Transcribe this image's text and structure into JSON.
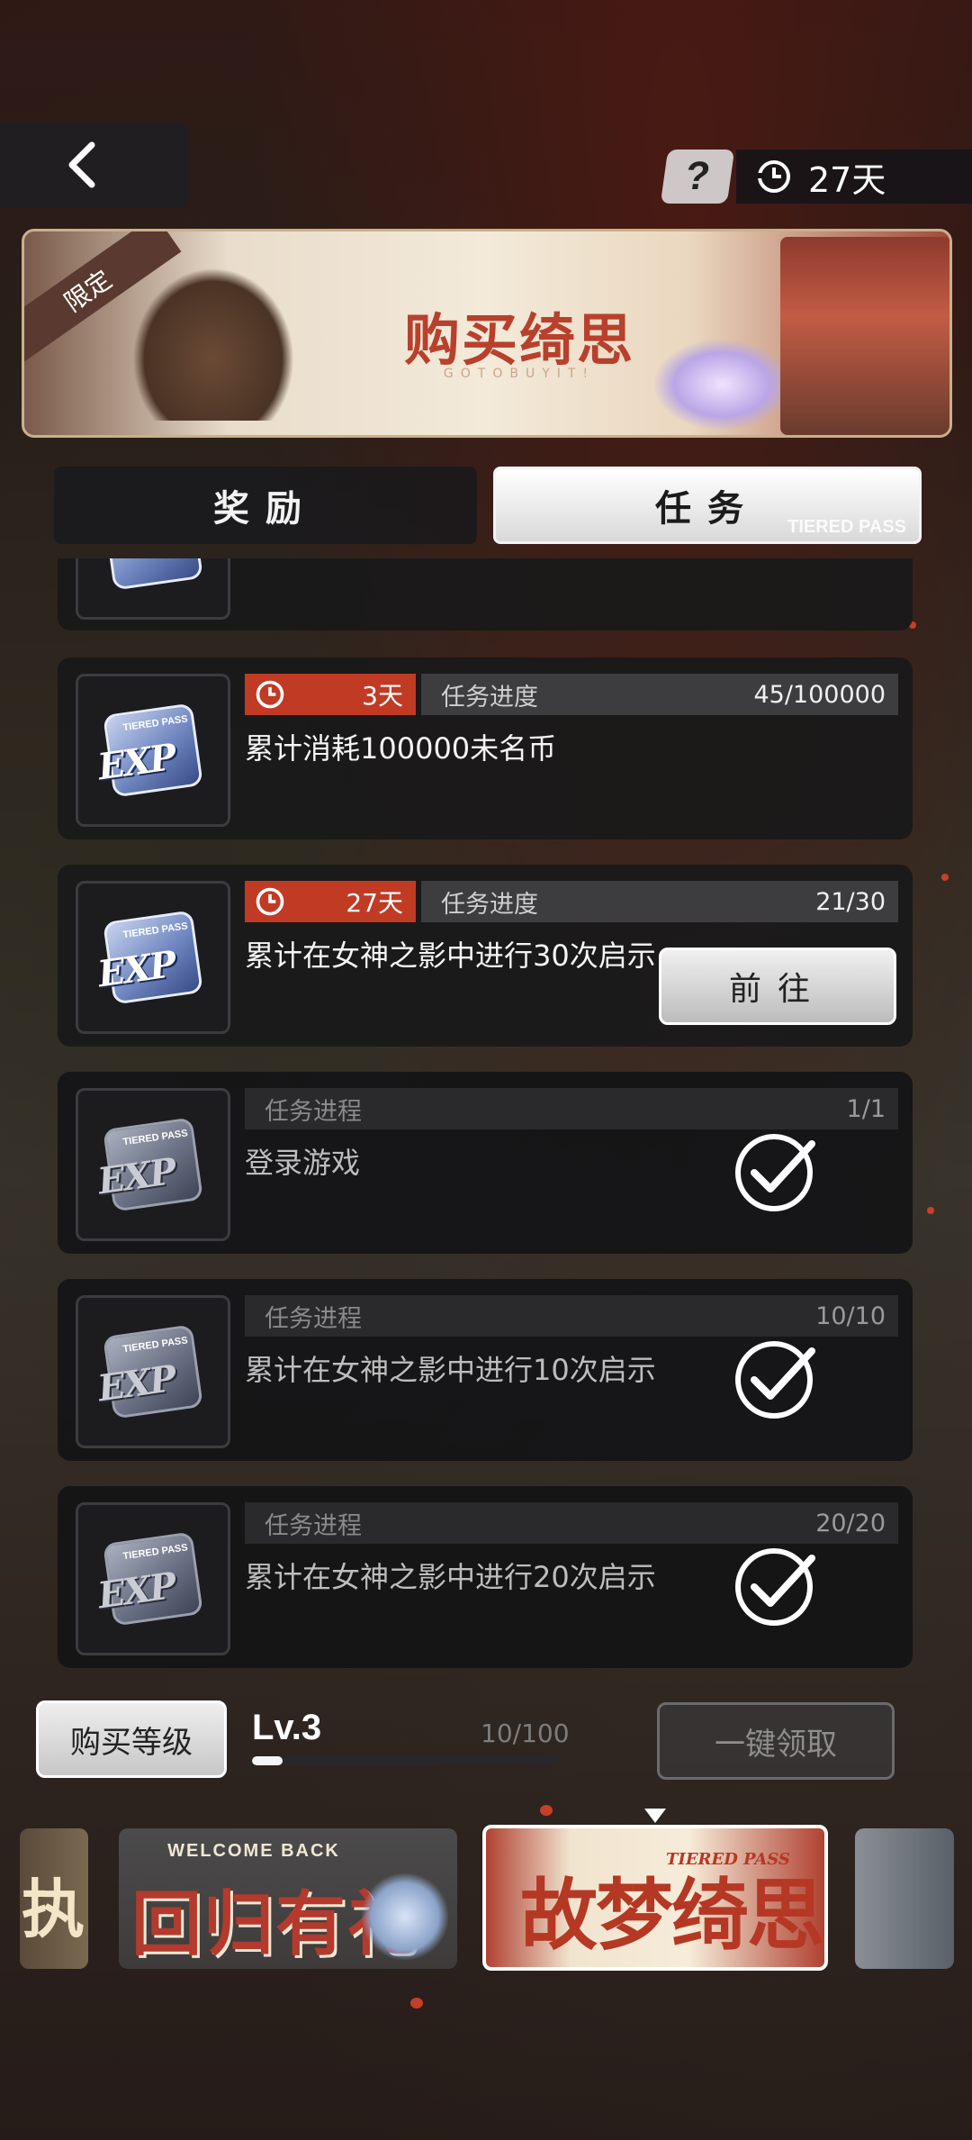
{
  "header": {
    "help_label": "?",
    "days_left": "27天"
  },
  "banner": {
    "ribbon": "限定",
    "title": "购买绮思",
    "subtitle": "GOTOBUYIT!"
  },
  "tabs": [
    {
      "label": "奖励",
      "active": false
    },
    {
      "label": "任务",
      "active": true,
      "sub": "TIERED PASS"
    }
  ],
  "tasks": [
    {
      "time": "3天",
      "progress_label": "任务进度",
      "progress": "45/100000",
      "title": "累计消耗100000未名币",
      "state": "in_progress"
    },
    {
      "time": "27天",
      "progress_label": "任务进度",
      "progress": "21/30",
      "title": "累计在女神之影中进行30次启示",
      "state": "go",
      "go_label": "前往"
    },
    {
      "progress_label": "任务进程",
      "progress": "1/1",
      "title": "登录游戏",
      "state": "done"
    },
    {
      "progress_label": "任务进程",
      "progress": "10/10",
      "title": "累计在女神之影中进行10次启示",
      "state": "done"
    },
    {
      "progress_label": "任务进程",
      "progress": "20/20",
      "title": "累计在女神之影中进行20次启示",
      "state": "done"
    }
  ],
  "exp_icon": {
    "text": "EXP",
    "mini": "TIERED PASS"
  },
  "level_bar": {
    "buy_label": "购买等级",
    "level": "Lv.3",
    "count": "10/100",
    "fraction": 0.1,
    "claim_all_label": "一键领取"
  },
  "carousel": {
    "left_partial": "执",
    "welcome_top": "WELCOME BACK",
    "welcome_main": "回归有礼",
    "tiered_main": "故梦绮思",
    "tiered_sub": "TIERED PASS"
  }
}
